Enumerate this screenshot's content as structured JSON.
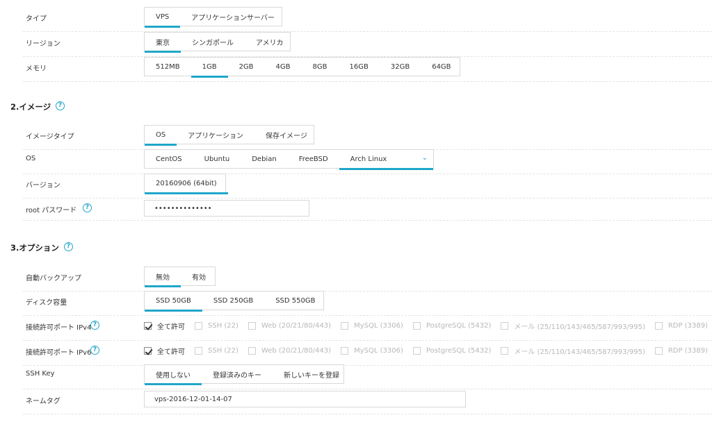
{
  "rows": {
    "type": {
      "label": "タイプ",
      "options": [
        "VPS",
        "アプリケーションサーバー"
      ]
    },
    "region": {
      "label": "リージョン",
      "options": [
        "東京",
        "シンガポール",
        "アメリカ"
      ]
    },
    "memory": {
      "label": "メモリ",
      "options": [
        "512MB",
        "1GB",
        "2GB",
        "4GB",
        "8GB",
        "16GB",
        "32GB",
        "64GB"
      ]
    },
    "image_type": {
      "label": "イメージタイプ",
      "options": [
        "OS",
        "アプリケーション",
        "保存イメージ"
      ]
    },
    "os": {
      "label": "OS",
      "options": [
        "CentOS",
        "Ubuntu",
        "Debian",
        "FreeBSD",
        "Arch Linux"
      ]
    },
    "version": {
      "label": "バージョン",
      "options": [
        "20160906 (64bit)"
      ]
    },
    "root_password": {
      "label": "root パスワード",
      "value": "••••••••••••••"
    },
    "auto_backup": {
      "label": "自動バックアップ",
      "options": [
        "無効",
        "有効"
      ]
    },
    "disk": {
      "label": "ディスク容量",
      "options": [
        "SSD 50GB",
        "SSD 250GB",
        "SSD 550GB"
      ]
    },
    "ipv4": {
      "label": "接続許可ポート IPv4"
    },
    "ipv6": {
      "label": "接続許可ポート IPv6"
    },
    "ssh_key": {
      "label": "SSH Key",
      "options": [
        "使用しない",
        "登録済みのキー",
        "新しいキーを登録"
      ]
    },
    "name_tag": {
      "label": "ネームタグ",
      "value": "vps-2016-12-01-14-07"
    }
  },
  "ports": [
    "全て許可",
    "SSH (22)",
    "Web (20/21/80/443)",
    "MySQL (3306)",
    "PostgreSQL (5432)",
    "メール (25/110/143/465/587/993/995)",
    "RDP (3389)"
  ],
  "sections": {
    "image": "2.イメージ",
    "option": "3.オプション"
  },
  "help_glyph": "?",
  "chevron_glyph": "⌄",
  "colors": {
    "accent": "#1fa6c9"
  }
}
